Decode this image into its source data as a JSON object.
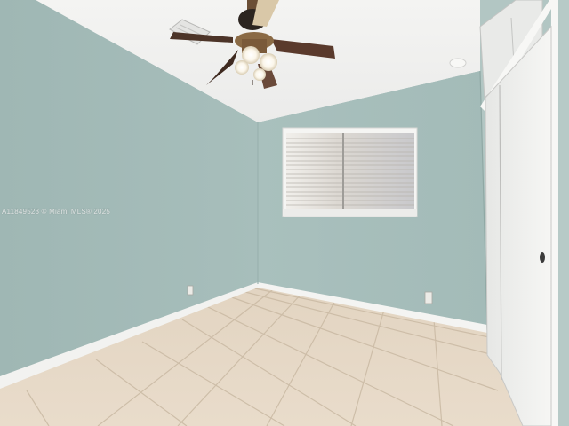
{
  "photo": {
    "subject": "empty-bedroom",
    "watermark_text": "A11849523 © Miami MLS® 2025"
  },
  "colors": {
    "left_wall": "#a3bab7",
    "back_wall": "#a9c1bd",
    "right_wall": "#b0c6c3",
    "ceiling": "#f1f1ef",
    "floor_tile": "#e7d9c6",
    "grout": "#cdbfac",
    "baseboard": "#f3f3f1",
    "closet_door": "#f4f4f2",
    "fan_blade": "#5a3a2c",
    "fan_metal": "#8a6a45"
  },
  "icons": {
    "ceiling_fan": "ceiling-fan-icon",
    "window_blinds": "window-blinds-icon",
    "closet_door": "sliding-closet-door",
    "outlet": "wall-outlet-icon",
    "smoke_detector": "smoke-detector-icon",
    "air_vent": "air-vent-icon"
  }
}
